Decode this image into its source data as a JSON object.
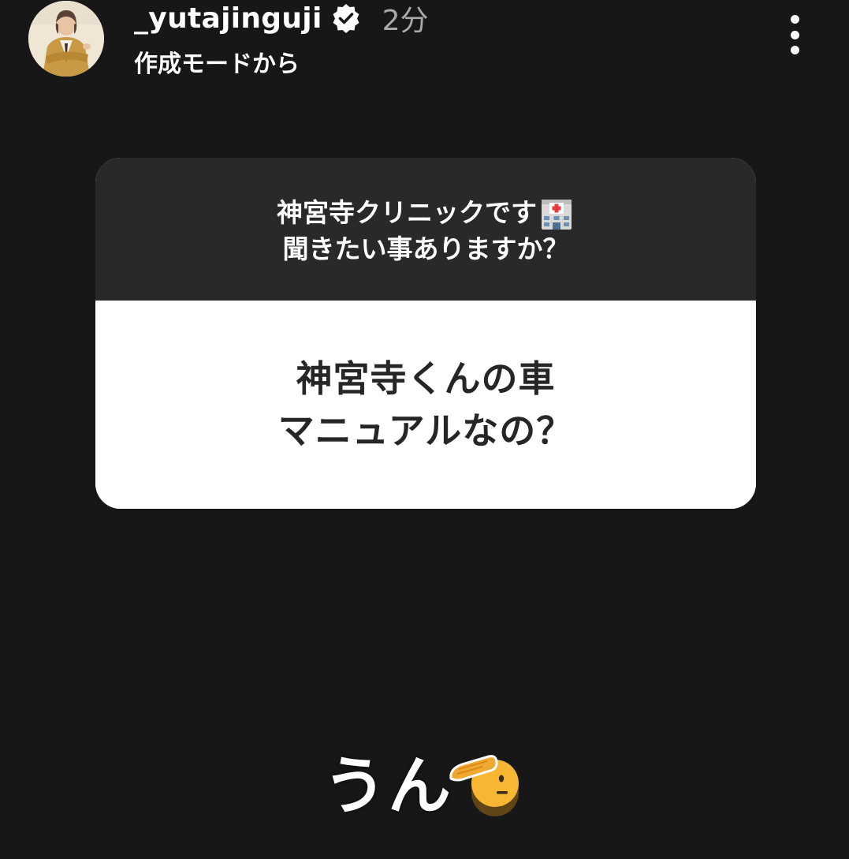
{
  "header": {
    "username": "_yutajinguji",
    "time": "2分",
    "subtitle": "作成モードから",
    "avatar_icon": "profile-photo",
    "verified_icon": "verified-badge-icon",
    "more_icon": "more-vertical-icon"
  },
  "question_card": {
    "prompt_line1": "神宮寺クリニックです",
    "prompt_icon": "hospital-emoji",
    "prompt_line2": "聞きたい事ありますか？",
    "answer_line1": "神宮寺くんの車",
    "answer_line2": "マニュアルなの？"
  },
  "reply": {
    "text": "うん",
    "icon": "saluting-face-emoji"
  },
  "colors": {
    "background": "#171717",
    "card_top": "#292929",
    "card_bottom": "#ffffff",
    "answer_text": "#262626",
    "time_text": "#a9a9a9",
    "emoji_yellow": "#f7b733"
  }
}
